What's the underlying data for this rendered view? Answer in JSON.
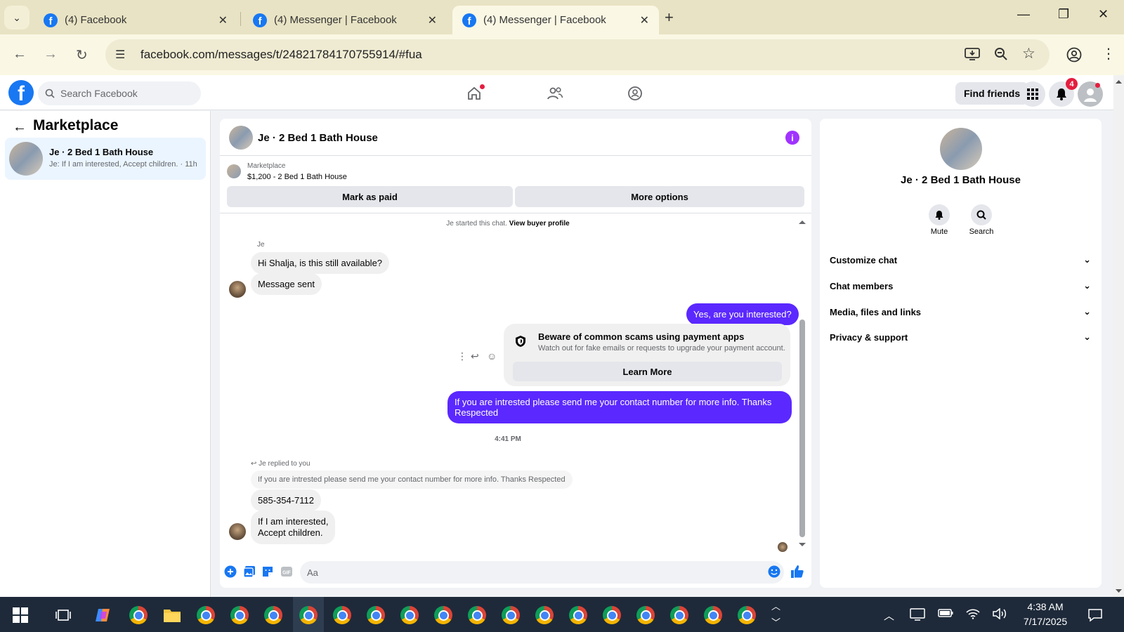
{
  "browser": {
    "tabs": [
      {
        "title": "(4) Facebook",
        "active": false
      },
      {
        "title": "(4) Messenger | Facebook",
        "active": false
      },
      {
        "title": "(4) Messenger | Facebook",
        "active": true
      }
    ],
    "url": "facebook.com/messages/t/24821784170755914/#fua"
  },
  "facebook": {
    "search_placeholder": "Search Facebook",
    "find_friends": "Find friends",
    "notification_count": "4",
    "logo_letter": "f"
  },
  "sidebar": {
    "title": "Marketplace",
    "conversations": [
      {
        "name": "Je · 2 Bed 1 Bath House",
        "preview": "Je: If I am interested, Accept children. · 11h"
      }
    ]
  },
  "chat": {
    "title": "Je · 2 Bed 1 Bath House",
    "marketplace_label": "Marketplace",
    "listing": "$1,200 - 2 Bed 1 Bath House",
    "mark_as_paid": "Mark as paid",
    "more_options": "More options",
    "started_text": "Je started this chat.",
    "view_buyer_profile": "View buyer profile",
    "sender_name": "Je",
    "messages": {
      "in1": "Hi Shalja, is this still available?",
      "in2": "Message sent",
      "out1": "Yes, are you interested?",
      "out2": "If you are intrested please send me your contact number for more info. Thanks Respected",
      "in3": "585-354-7112",
      "in4_line1": "If I am interested,",
      "in4_line2": "Accept children."
    },
    "scam_notice": {
      "title": "Beware of common scams using payment apps",
      "subtitle": "Watch out for fake emails or requests to upgrade your payment account.",
      "button": "Learn More"
    },
    "timestamp": "4:41 PM",
    "reply_label": "Je replied to you",
    "quoted_text": "If you are intrested please send me your contact number for more info. Thanks Respected",
    "composer_placeholder": "Aa"
  },
  "right_panel": {
    "name": "Je · 2 Bed 1 Bath House",
    "mute": "Mute",
    "search": "Search",
    "sections": [
      "Customize chat",
      "Chat members",
      "Media, files and links",
      "Privacy & support"
    ]
  },
  "taskbar": {
    "time": "4:38 AM",
    "date": "7/17/2025"
  },
  "colors": {
    "facebook_blue": "#1877f2",
    "outgoing_bubble": "#5b28ff",
    "info_purple": "#a033ff",
    "badge_red": "#e41e3f"
  }
}
